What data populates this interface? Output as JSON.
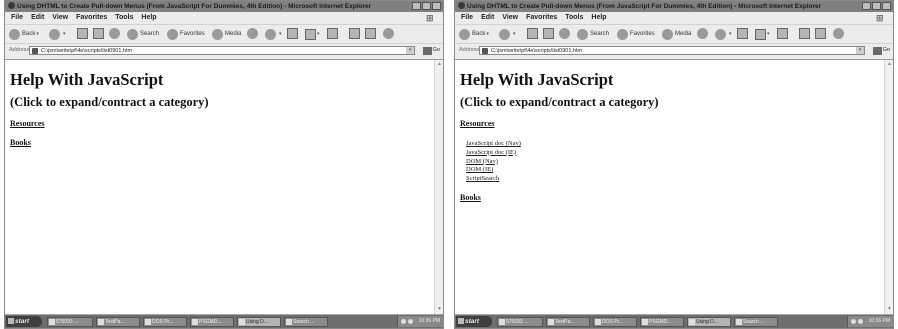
{
  "windows": [
    {
      "title": "Using DHTML to Create Pull-down Menus (From JavaScript For Dummies, 4th Edition) - Microsoft Internet Explorer",
      "menu": [
        "File",
        "Edit",
        "View",
        "Favorites",
        "Tools",
        "Help"
      ],
      "toolbar": {
        "back": "Back",
        "search": "Search",
        "favorites": "Favorites",
        "media": "Media"
      },
      "address": {
        "label": "Address",
        "url": "C:\\jsm\\write\\pf\\4e\\scripts\\list0901.htm",
        "go": "Go"
      },
      "page": {
        "heading": "Help With JavaScript",
        "subheading": "(Click to expand/contract a category)",
        "categories": [
          {
            "label": "Resources",
            "expanded": false,
            "items": []
          },
          {
            "label": "Books",
            "expanded": false,
            "items": []
          }
        ]
      },
      "taskbar": {
        "start": "start",
        "tasks": [
          "576093 ...",
          "TextPa...",
          "DOS Pr...",
          "PSGMD...",
          "Using D...",
          "Search ..."
        ],
        "active_task": 4,
        "clock": "10:36 PM"
      }
    },
    {
      "title": "Using DHTML to Create Pull-down Menus (From JavaScript For Dummies, 4th Edition) - Microsoft Internet Explorer",
      "menu": [
        "File",
        "Edit",
        "View",
        "Favorites",
        "Tools",
        "Help"
      ],
      "toolbar": {
        "back": "Back",
        "search": "Search",
        "favorites": "Favorites",
        "media": "Media"
      },
      "address": {
        "label": "Address",
        "url": "C:\\jsm\\write\\pf\\4e\\scripts\\list0901.htm",
        "go": "Go"
      },
      "page": {
        "heading": "Help With JavaScript",
        "subheading": "(Click to expand/contract a category)",
        "categories": [
          {
            "label": "Resources",
            "expanded": true,
            "items": [
              "JavaScript doc (Nav)",
              "JavaScript doc (IE)",
              "DOM (Nav)",
              "DOM (IE)",
              "ScriptSearch"
            ]
          },
          {
            "label": "Books",
            "expanded": false,
            "items": []
          }
        ]
      },
      "taskbar": {
        "start": "start",
        "tasks": [
          "576093 ...",
          "TextPa...",
          "DOS Pr...",
          "PSGMD...",
          "Using D...",
          "Search ..."
        ],
        "active_task": 4,
        "clock": "10:36 PM"
      }
    }
  ]
}
